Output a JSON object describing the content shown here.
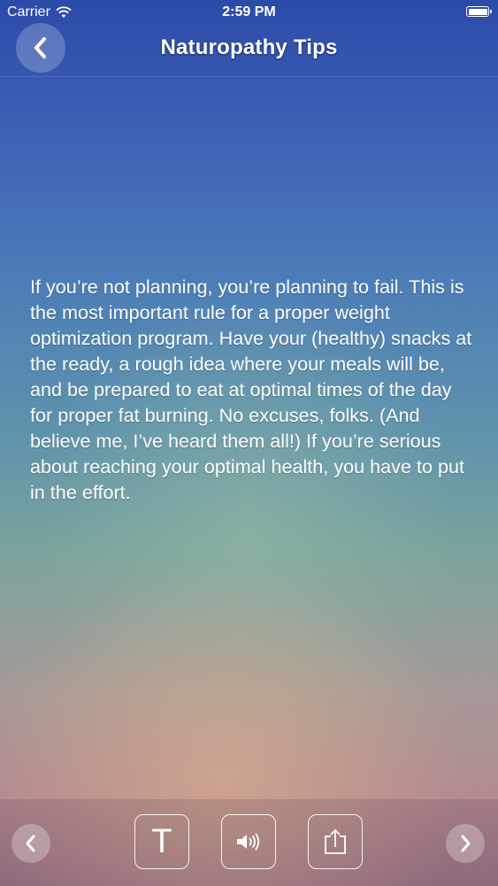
{
  "status_bar": {
    "carrier": "Carrier",
    "time": "2:59 PM",
    "icons": [
      "wifi-icon",
      "battery-icon"
    ]
  },
  "nav": {
    "title": "Naturopathy Tips",
    "back_icon": "chevron-left-icon"
  },
  "content": {
    "tip_text": "If you’re not planning, you’re planning to fail. This is the most important rule for a proper weight optimization program. Have your (healthy) snacks at the ready, a rough idea where your meals will be, and be prepared to eat at optimal times of the day for proper fat burning. No excuses, folks. (And believe me, I’ve heard them all!) If you’re serious about reaching your optimal health, you have to put in the effort."
  },
  "toolbar": {
    "prev_icon": "chevron-left-icon",
    "text_size_label": "T",
    "speak_icon": "speaker-icon",
    "share_icon": "share-icon",
    "next_icon": "chevron-right-icon"
  }
}
